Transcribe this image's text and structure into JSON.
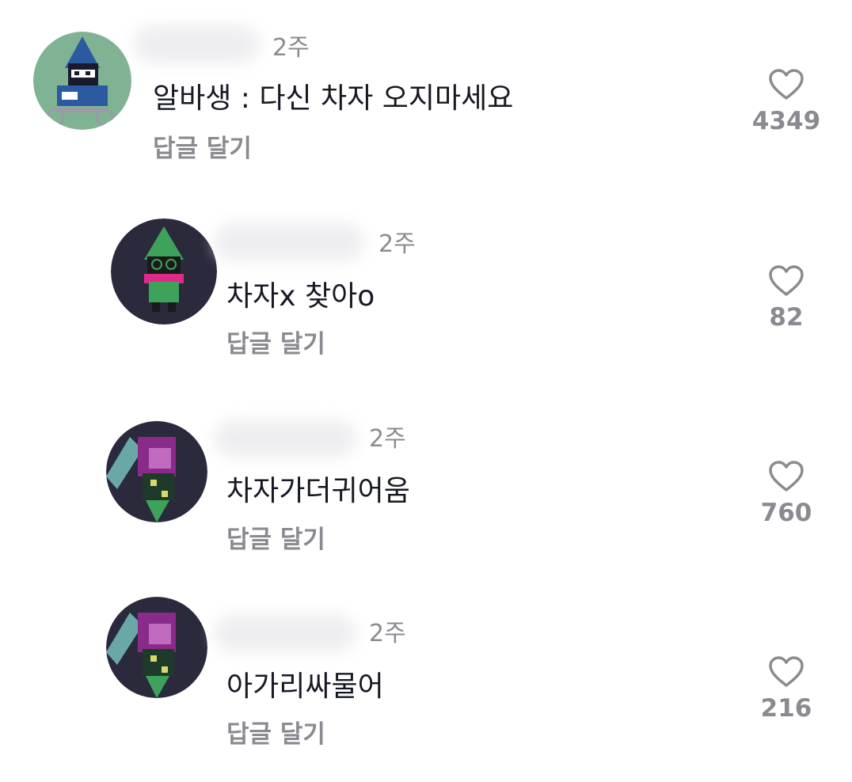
{
  "comments": [
    {
      "time": "2주",
      "text": "알바생 : 다신 차자 오지마세요",
      "reply_label": "답글 달기",
      "likes": "4349",
      "avatar": "lancer-avatar"
    },
    {
      "time": "2주",
      "text": "차자x 찾아o",
      "reply_label": "답글 달기",
      "likes": "82",
      "avatar": "ralsei-avatar"
    },
    {
      "time": "2주",
      "text": "차자가더귀어움",
      "reply_label": "답글 달기",
      "likes": "760",
      "avatar": "susie-avatar"
    },
    {
      "time": "2주",
      "text": "아가리싸물어",
      "reply_label": "답글 달기",
      "likes": "216",
      "avatar": "susie-avatar"
    }
  ],
  "icons": {
    "like": "heart-outline-icon"
  },
  "colors": {
    "text": "#161823",
    "muted": "#8a8b91"
  }
}
